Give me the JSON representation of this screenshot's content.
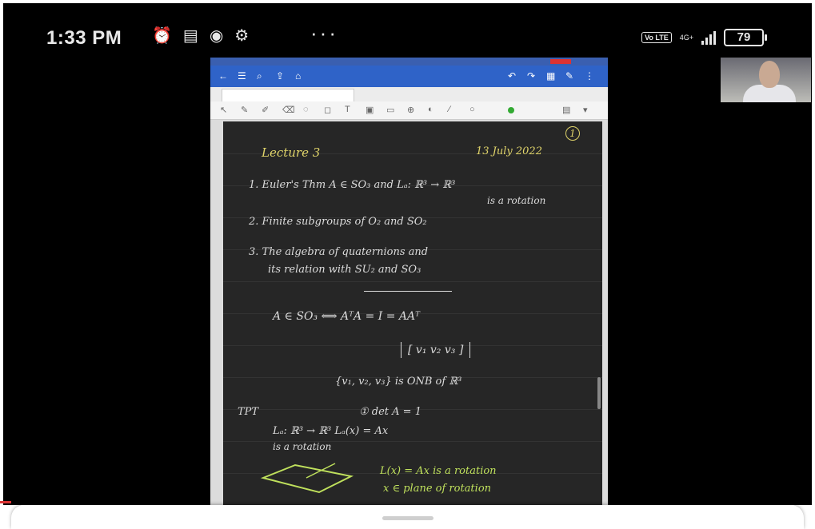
{
  "status_bar": {
    "time": "1:33 PM",
    "notification_icons": [
      "alarm-icon",
      "news-icon",
      "chrome-icon",
      "settings-icon"
    ],
    "more": "···",
    "volte": "Vo LTE",
    "network": "4G+",
    "battery": "79"
  },
  "shared_screen": {
    "page": {
      "page_number": "1",
      "heading": "Lecture 3",
      "date": "13 July 2022",
      "items": [
        "1. Euler's Thm   A ∈ SO₃ and Lₐ: ℝ³ → ℝ³",
        "is a rotation",
        "2. Finite subgroups of O₂ and SO₂",
        "3. The algebra of quaternions and",
        "its relation with SU₂ and SO₃"
      ],
      "equation_1": "A ∈ SO₃  ⟺  AᵀA = I = AAᵀ",
      "matrix": "[ v₁  v₂  v₃ ]",
      "basis": "{v₁, v₂, v₃} is ONB of ℝ³",
      "tpt_label": "TPT",
      "tpt_1": "① det A = 1",
      "tpt_2": "Lₐ: ℝ³ → ℝ³   Lₐ(x) = Ax",
      "tpt_3": "is a rotation",
      "green_1": "L(x) = Ax is a rotation",
      "green_2": "x ∈ plane of rotation"
    }
  },
  "colors": {
    "page_bg": "#262626",
    "toolbar": "#2f63c8",
    "ink_yellow": "#e0d46a",
    "ink_white": "#dcdcdc",
    "ink_green": "#bfe05c"
  }
}
